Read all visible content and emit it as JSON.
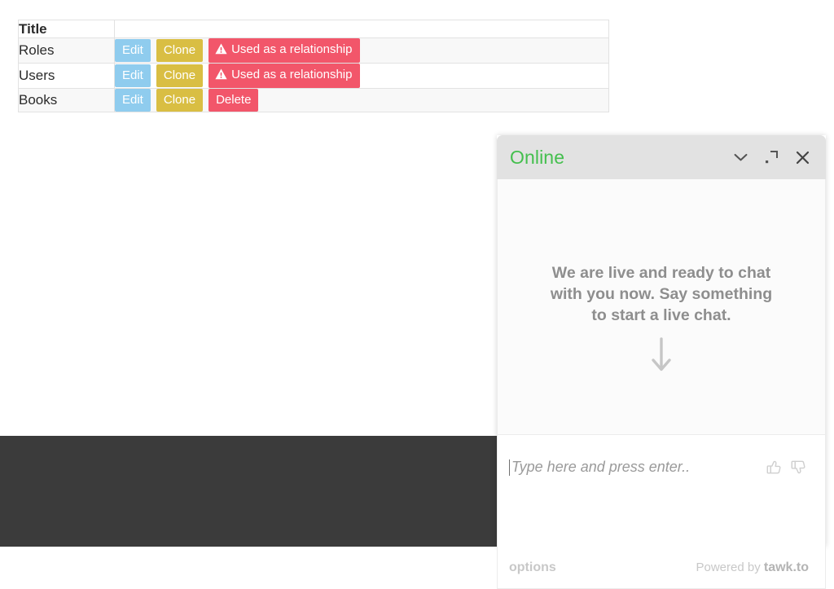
{
  "table": {
    "columns": [
      "Title",
      ""
    ],
    "rows": [
      {
        "title": "Roles",
        "actions": [
          {
            "label": "Edit",
            "kind": "edit"
          },
          {
            "label": "Clone",
            "kind": "clone"
          },
          {
            "label": "Used as a relationship",
            "kind": "relationship",
            "icon": "warning-triangle-icon"
          }
        ]
      },
      {
        "title": "Users",
        "actions": [
          {
            "label": "Edit",
            "kind": "edit"
          },
          {
            "label": "Clone",
            "kind": "clone"
          },
          {
            "label": "Used as a relationship",
            "kind": "relationship",
            "icon": "warning-triangle-icon"
          }
        ]
      },
      {
        "title": "Books",
        "actions": [
          {
            "label": "Edit",
            "kind": "edit"
          },
          {
            "label": "Clone",
            "kind": "clone"
          },
          {
            "label": "Delete",
            "kind": "delete"
          }
        ]
      }
    ]
  },
  "colors": {
    "edit_button": "#8fccee",
    "clone_button": "#d9be43",
    "delete_button": "#f2566a",
    "relationship_button": "#f2566a",
    "online_status": "#44bf4e",
    "chat_header_bg": "#e2e2e2",
    "dark_bar": "#3b3b3b"
  },
  "chat": {
    "status": "Online",
    "header_icons": [
      {
        "name": "chevron-down-icon",
        "title": "Minimize"
      },
      {
        "name": "expand-icon",
        "title": "Maximize"
      },
      {
        "name": "close-icon",
        "title": "Close"
      }
    ],
    "prompt": "We are live and ready to chat with you now. Say something to start a live chat.",
    "arrow_icon": "arrow-down-icon",
    "input": {
      "value": "",
      "placeholder": "Type here and press enter.."
    },
    "rating_icons": [
      {
        "name": "thumbs-up-icon",
        "title": "Good"
      },
      {
        "name": "thumbs-down-icon",
        "title": "Bad"
      }
    ],
    "footer": {
      "options_label": "options",
      "powered_prefix": "Powered by ",
      "powered_brand": "tawk.to"
    }
  }
}
